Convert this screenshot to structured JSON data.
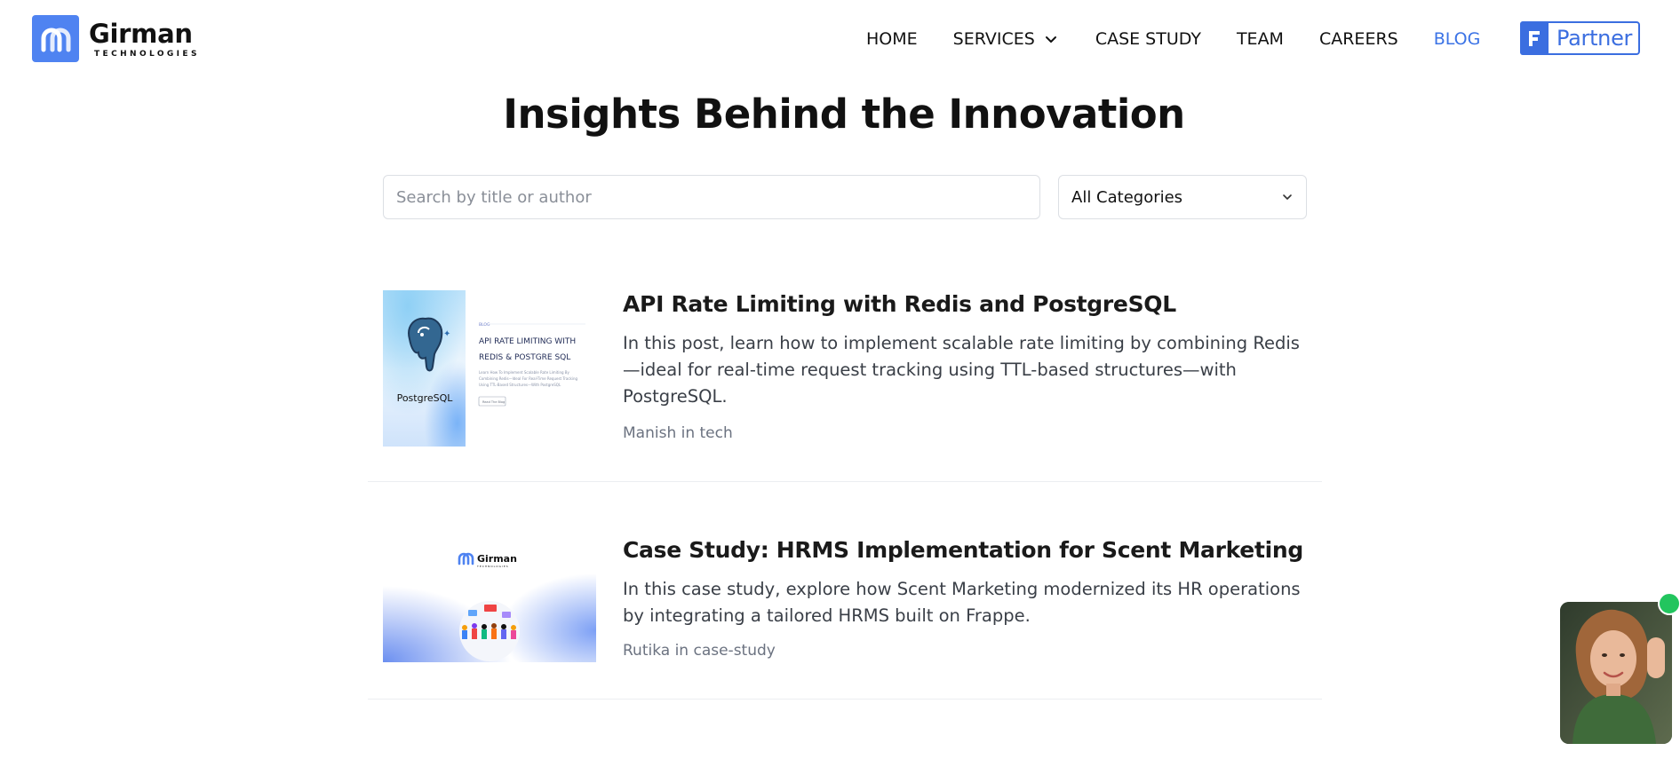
{
  "brand": {
    "name": "Girman",
    "tagline": "TECHNOLOGIES",
    "accent": "#4f83f1"
  },
  "nav": {
    "items": [
      {
        "label": "HOME",
        "active": false
      },
      {
        "label": "SERVICES",
        "active": false,
        "has_dropdown": true
      },
      {
        "label": "CASE STUDY",
        "active": false
      },
      {
        "label": "TEAM",
        "active": false
      },
      {
        "label": "CAREERS",
        "active": false
      },
      {
        "label": "BLOG",
        "active": true
      }
    ],
    "active_color": "#3b73e6",
    "partner_label": "Partner"
  },
  "page": {
    "title": "Insights Behind the Innovation"
  },
  "filters": {
    "search_placeholder": "Search by title or author",
    "category_selected": "All Categories"
  },
  "posts": [
    {
      "title": "API Rate Limiting with Redis and PostgreSQL",
      "description": "In this post, learn how to implement scalable rate limiting by combining Redis—ideal for real-time request tracking using TTL-based structures—with PostgreSQL.",
      "meta": "Manish in tech",
      "thumbnail": {
        "tag": "BLOG",
        "heading_line1": "API RATE LIMITING WITH",
        "heading_line2": "REDIS & POSTGRE SQL",
        "body": "Learn How To Implement Scalable Rate Limiting By Combining Redis—Ideal For Real-Time Request Tracking Using TTL-Based Structures—With PostgreSQL",
        "button": "Read The Blog",
        "logo_label": "PostgreSQL",
        "icon": "postgresql-elephant-icon"
      }
    },
    {
      "title": "Case Study: HRMS Implementation for Scent Marketing",
      "description": "In this case study, explore how Scent Marketing modernized its HR operations by integrating a tailored HRMS built on Frappe.",
      "meta": "Rutika in case-study",
      "thumbnail": {
        "logo_name": "Girman",
        "logo_sub": "TECHNOLOGIES",
        "icon": "team-illustration-icon"
      }
    }
  ],
  "video_widget": {
    "status_color": "#22c55e"
  }
}
